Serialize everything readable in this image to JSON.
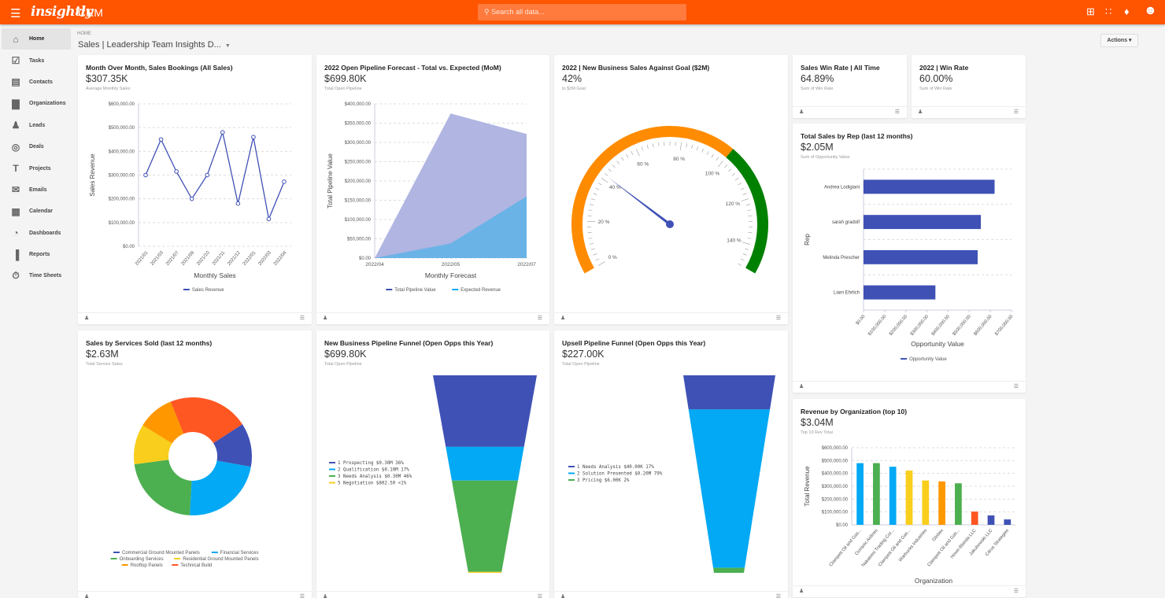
{
  "topbar": {
    "brand": "insightly",
    "app": "CRM",
    "search_placeholder": "Search all data...",
    "brand_color": "#FF5400"
  },
  "sidebar": {
    "items": [
      {
        "label": "Home",
        "icon": "home-icon",
        "glyph": "⌂"
      },
      {
        "label": "Tasks",
        "icon": "tasks-icon",
        "glyph": "☑"
      },
      {
        "label": "Contacts",
        "icon": "contacts-icon",
        "glyph": "▤"
      },
      {
        "label": "Organizations",
        "icon": "organizations-icon",
        "glyph": "▇"
      },
      {
        "label": "Leads",
        "icon": "leads-icon",
        "glyph": "♟"
      },
      {
        "label": "Deals",
        "icon": "deals-icon",
        "glyph": "◎"
      },
      {
        "label": "Projects",
        "icon": "projects-icon",
        "glyph": "T"
      },
      {
        "label": "Emails",
        "icon": "emails-icon",
        "glyph": "✉"
      },
      {
        "label": "Calendar",
        "icon": "calendar-icon",
        "glyph": "▦"
      },
      {
        "label": "Dashboards",
        "icon": "dashboards-icon",
        "glyph": "◔"
      },
      {
        "label": "Reports",
        "icon": "reports-icon",
        "glyph": "▐"
      },
      {
        "label": "Time Sheets",
        "icon": "stopwatch-icon",
        "glyph": "⏱"
      }
    ]
  },
  "header": {
    "breadcrumb": "HOME",
    "title": "Sales | Leadership Team Insights D...",
    "actions": "Actions ▾"
  },
  "cards": {
    "monthly": {
      "title": "Month Over Month, Sales Bookings (All Sales)",
      "value": "$307.35K",
      "subtitle": "Average Monthly Sales"
    },
    "pipeline": {
      "title": "2022 Open Pipeline Forecast - Total vs. Expected (MoM)",
      "value": "$699.80K",
      "subtitle": "Total Open Pipeline"
    },
    "goal": {
      "title": "2022 | New Business Sales Against Goal ($2M)",
      "value": "42%",
      "subtitle": "to $2M Goal"
    },
    "winall": {
      "title": "Sales Win Rate | All Time",
      "value": "64.89%",
      "subtitle": "Sum of Win Rate"
    },
    "win2022": {
      "title": "2022 | Win Rate",
      "value": "60.00%",
      "subtitle": "Sum of Win Rate"
    },
    "rep": {
      "title": "Total Sales by Rep (last 12 months)",
      "value": "$2.05M",
      "subtitle": "Sum of Opportunity Value"
    },
    "services": {
      "title": "Sales by Services Sold (last 12 months)",
      "value": "$2.63M",
      "subtitle": "Total Service Sales"
    },
    "nbfunnel": {
      "title": "New Business Pipeline Funnel (Open Opps this Year)",
      "value": "$699.80K",
      "subtitle": "Total Open Pipeline"
    },
    "upfunnel": {
      "title": "Upsell Pipeline Funnel (Open Opps this Year)",
      "value": "$227.00K",
      "subtitle": "Total Open Pipeline"
    },
    "org": {
      "title": "Revenue by Organization (top 10)",
      "value": "$3.04M",
      "subtitle": "Top 10 Rev Total"
    }
  },
  "chart_data": [
    {
      "id": "monthly",
      "type": "line",
      "xlabel": "Monthly Sales",
      "ylabel": "Sales Revenue",
      "ylim": [
        0,
        600000
      ],
      "yticks": [
        "$0.00",
        "$100,000.00",
        "$200,000.00",
        "$300,000.00",
        "$400,000.00",
        "$500,000.00",
        "$600,000.00"
      ],
      "categories": [
        "2021/01",
        "2021/03",
        "2021/07",
        "2021/09",
        "2021/10",
        "2021/11",
        "2021/12",
        "2022/01",
        "2022/03",
        "2022/04"
      ],
      "series": [
        {
          "name": "Sales Revenue",
          "color": "#3F51B5",
          "values": [
            300000,
            450000,
            315000,
            200000,
            300000,
            480000,
            180000,
            460000,
            115000,
            272000
          ]
        }
      ],
      "grid": true,
      "legend": "bottom"
    },
    {
      "id": "pipeline",
      "type": "area",
      "xlabel": "Monthly Forecast",
      "ylabel": "Total Pipeline Value",
      "ylim": [
        0,
        400000
      ],
      "yticks": [
        "$0.00",
        "$50,000.00",
        "$100,000.00",
        "$150,000.00",
        "$200,000.00",
        "$250,000.00",
        "$300,000.00",
        "$350,000.00",
        "$400,000.00"
      ],
      "categories": [
        "2022/04",
        "2022/05",
        "2022/07"
      ],
      "series": [
        {
          "name": "Total Pipeline Value",
          "color": "#3F51B5",
          "values": [
            0,
            375000,
            322000
          ]
        },
        {
          "name": "Expected Revenue",
          "color": "#03A9F4",
          "values": [
            0,
            38000,
            160000
          ]
        }
      ],
      "grid": true,
      "legend": "bottom"
    },
    {
      "id": "goal",
      "type": "gauge",
      "value": 42,
      "min": 0,
      "max": 150,
      "ticks": [
        "0 %",
        "20 %",
        "40 %",
        "60 %",
        "80 %",
        "100 %",
        "120 %",
        "140 %"
      ],
      "bands": [
        {
          "from": 0,
          "to": 100,
          "color": "#FF8C00"
        },
        {
          "from": 100,
          "to": 150,
          "color": "#008000"
        }
      ],
      "needle_color": "#3F51B5"
    },
    {
      "id": "rep",
      "type": "bar",
      "orientation": "horizontal",
      "xlabel": "Opportunity Value",
      "ylabel": "Rep",
      "xlim": [
        0,
        700000
      ],
      "xticks": [
        "$0.00",
        "$100,000.00",
        "$200,000.00",
        "$300,000.00",
        "$400,000.00",
        "$500,000.00",
        "$600,000.00",
        "$700,000.00"
      ],
      "categories": [
        "Andrea Lodigiani",
        "sarah gradolf",
        "Melinda Prescher",
        "Liam Ehrlich"
      ],
      "series": [
        {
          "name": "Opportunity Value",
          "color": "#3F51B5",
          "values": [
            620000,
            555000,
            540000,
            340000
          ]
        }
      ],
      "legend": "bottom"
    },
    {
      "id": "services",
      "type": "pie",
      "donut": true,
      "categories": [
        "Commercial Ground Mounted Panels",
        "Financial Services",
        "Onboarding Services",
        "Residential Ground Mounted Panels",
        "Rooftop Panels",
        "Technical Build"
      ],
      "values": [
        12,
        23,
        22,
        11,
        10,
        22
      ],
      "colors": [
        "#3F51B5",
        "#03A9F4",
        "#4CAF50",
        "#F9CE1D",
        "#FF9800",
        "#FF5722"
      ],
      "legend": "bottom"
    },
    {
      "id": "nbfunnel",
      "type": "funnel",
      "legend_items": [
        "1 Prospecting $0.30M  36%",
        "2 Qualification $0.10M  17%",
        "3 Needs Analysis $0.30M  46%",
        "5 Negotiation $802.50  <1%"
      ],
      "values": [
        36,
        17,
        46,
        0.5
      ],
      "colors": [
        "#3F51B5",
        "#03A9F4",
        "#4CAF50",
        "#F9CE1D"
      ]
    },
    {
      "id": "upfunnel",
      "type": "funnel",
      "legend_items": [
        "1 Needs Analysis $40.00K  17%",
        "2 Solution Presented $0.20M  79%",
        "3 Pricing $6.00K  2%"
      ],
      "values": [
        17,
        79,
        2.5
      ],
      "colors": [
        "#3F51B5",
        "#03A9F4",
        "#4CAF50"
      ]
    },
    {
      "id": "org",
      "type": "bar",
      "xlabel": "Organization",
      "ylabel": "Total Revenue",
      "ylim": [
        0,
        600000
      ],
      "yticks": [
        "$0.00",
        "$100,000.00",
        "$200,000.00",
        "$300,000.00",
        "$400,000.00",
        "$500,000.00",
        "$600,000.00"
      ],
      "categories": [
        "Clampett Oil and Gas...",
        "Oceanic Airlines",
        "Nakatomi Trading Cor...",
        "Clampett Oil and Gas...",
        "Warbucks Industries",
        "Globex",
        "Clampett Oil and Gas...",
        "Howe-Blanda LLC",
        "Jakubowski LLC",
        "Citrus Strategies"
      ],
      "values": [
        480000,
        480000,
        452000,
        422000,
        345000,
        338000,
        323000,
        103000,
        73000,
        42000
      ],
      "colors": [
        "#03A9F4",
        "#4CAF50",
        "#03A9F4",
        "#F9CE1D",
        "#F9CE1D",
        "#FF9800",
        "#4CAF50",
        "#FF5722",
        "#3F51B5",
        "#3F51B5"
      ]
    }
  ]
}
